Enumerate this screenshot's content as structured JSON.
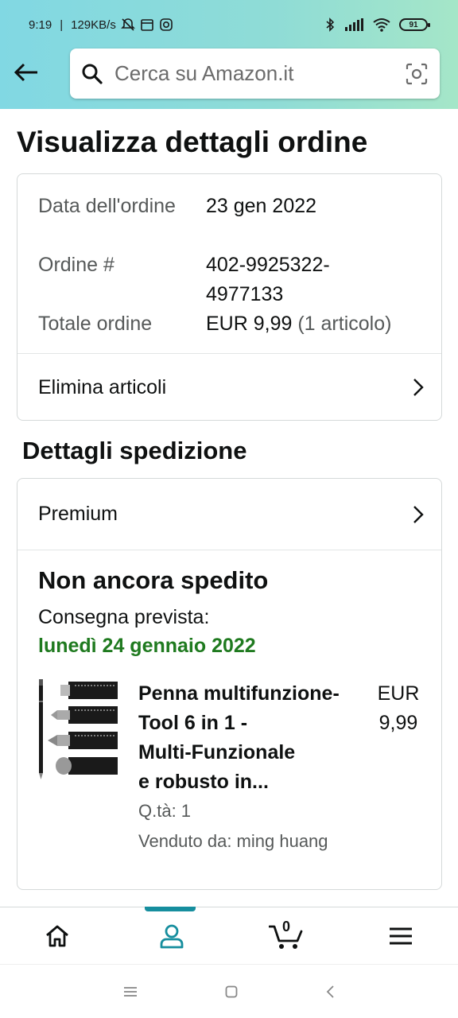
{
  "status_bar": {
    "time": "9:19",
    "network_speed": "129KB/s",
    "battery": "91"
  },
  "search": {
    "placeholder": "Cerca su Amazon.it"
  },
  "page": {
    "title": "Visualizza dettagli ordine"
  },
  "order_summary": {
    "date_label": "Data dell'ordine",
    "date_value": "23 gen 2022",
    "order_label": "Ordine #",
    "order_value": "402-9925322-4977133",
    "total_label": "Totale ordine",
    "total_value": "EUR 9,99",
    "total_items": "(1 articolo)",
    "remove_items_link": "Elimina articoli"
  },
  "shipping": {
    "section_title": "Dettagli spedizione",
    "shipping_type": "Premium",
    "status_heading": "Non ancora spedito",
    "delivery_label": "Consegna prevista:",
    "delivery_date": "lunedì 24 gennaio 2022",
    "item": {
      "title": "Penna multifunzione-Tool 6 in 1 - Multi-Funzionale e robusto in...",
      "title_lines": [
        "Penna multifunzione-",
        "Tool 6 in 1 -",
        "Multi-Funzionale",
        "e robusto in..."
      ],
      "price_currency": "EUR",
      "price_value": "9,99",
      "quantity": "Q.tà: 1",
      "seller": "Venduto da: ming huang"
    }
  },
  "bottom_nav": {
    "items": [
      "home-icon",
      "account-icon",
      "cart-icon",
      "menu-icon"
    ],
    "active": "account-icon",
    "cart_count": "0",
    "accent_color": "#168e9e"
  },
  "colors": {
    "delivery_green": "#1f7a1f",
    "header_gradient_start": "#81d8e3",
    "header_gradient_end": "#a5e6c8"
  }
}
